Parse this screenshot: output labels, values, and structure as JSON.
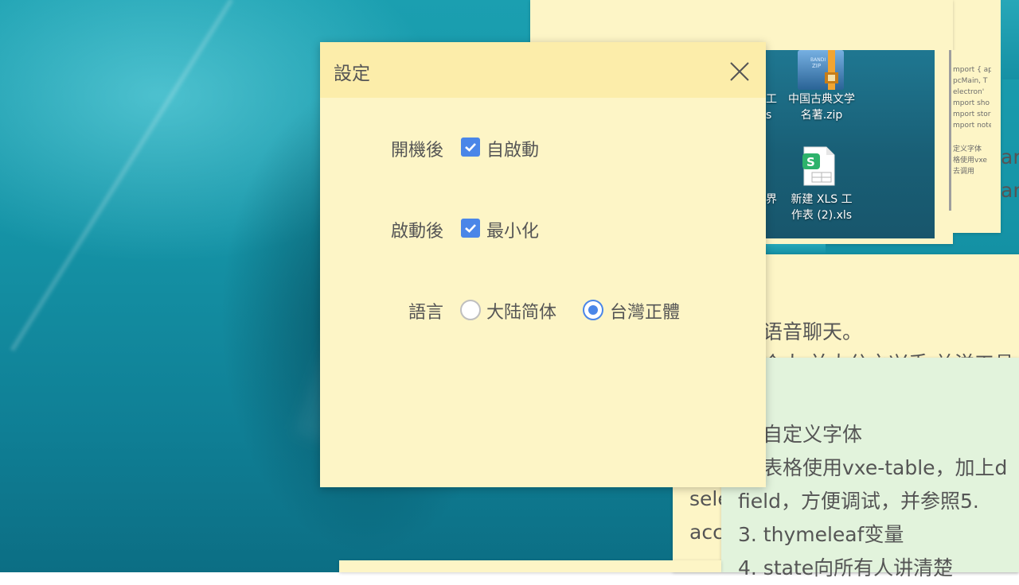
{
  "dialog": {
    "title": "設定",
    "rows": {
      "startup": {
        "label": "開機後",
        "option": "自啟動",
        "checked": true
      },
      "after_launch": {
        "label": "啟動後",
        "option": "最小化",
        "checked": true
      },
      "language": {
        "label": "語言",
        "options": [
          {
            "label": "大陆简体",
            "selected": false
          },
          {
            "label": "台灣正體",
            "selected": true
          }
        ]
      }
    }
  },
  "background_notes": {
    "screenshot": {
      "zip_icon_badge": "BANDI\nZIP",
      "zip_file": "中国古典文学\n名著.zip",
      "xls_file": "新建 XLS 工\n作表 (2).xls",
      "cut_text_1": "工\ns",
      "cut_text_2": "界"
    },
    "code_snippet": [
      "mport { ap",
      "pcMain, T",
      "electron'",
      "mport sho",
      "mport stor",
      "mport note",
      "定义字体",
      "格使用vxe",
      "   去调用"
    ],
    "right_edge": [
      "ar",
      "ar"
    ],
    "mid_note_lines": [
      "语音聊天。",
      "个人 并大分之兴手 关洋工具"
    ],
    "mid_note_partial": [
      "sele",
      "acc"
    ],
    "green_note_lines": [
      "自定义字体",
      "表格使用vxe-table，加上d",
      "field，方便调试，并参照5.",
      "3. thymeleaf变量",
      "4. state向所有人讲清楚"
    ]
  },
  "colors": {
    "note_yellow": "#fdf5c6",
    "dialog_header": "#fcedaa",
    "note_green": "#e2f3dc",
    "accent": "#4a86e8",
    "text": "#555555"
  }
}
